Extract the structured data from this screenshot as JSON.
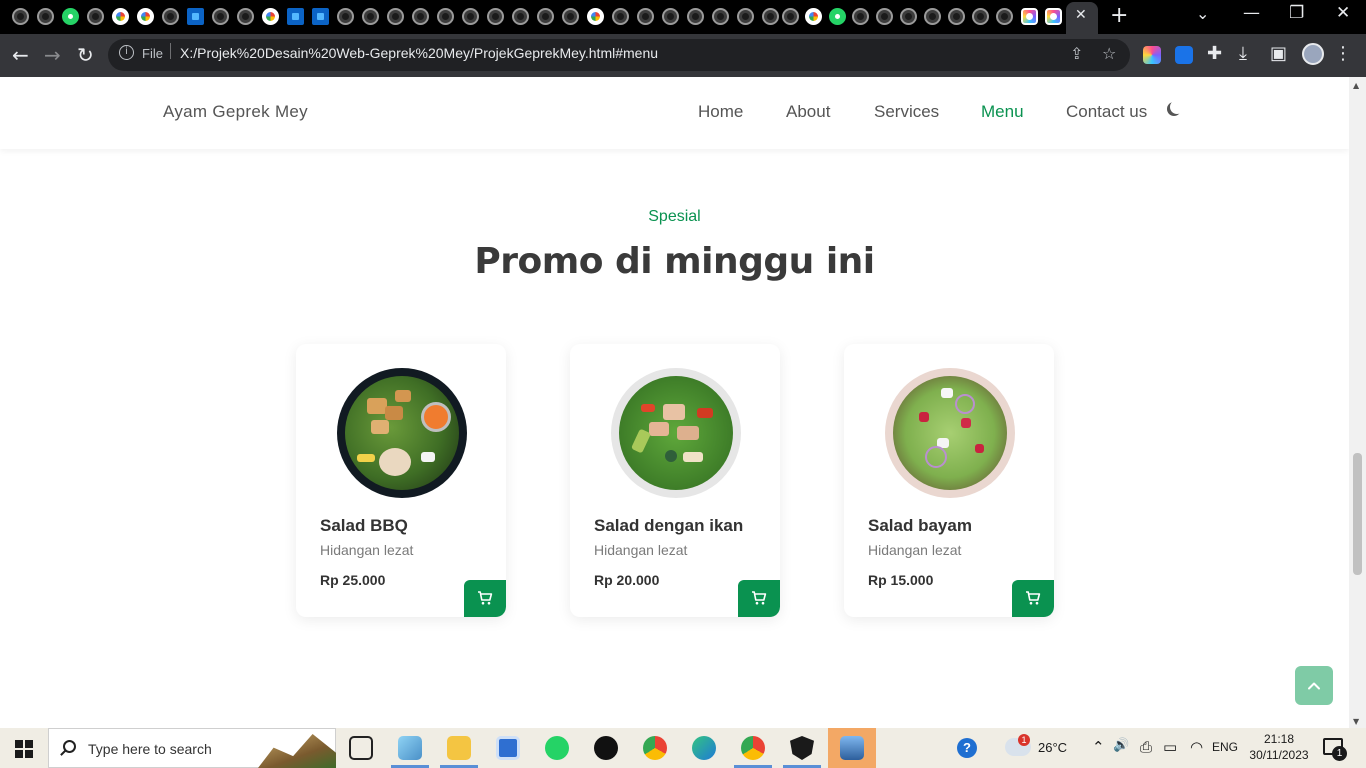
{
  "browser": {
    "tab_close_glyph": "✕",
    "new_tab_glyph": "+",
    "tab_search_glyph": "⌄",
    "window_controls": {
      "minimize": "—",
      "maximize": "❐",
      "close": "✕"
    },
    "nav": {
      "back": "←",
      "forward": "→",
      "reload": "↻"
    },
    "address": {
      "scheme_label": "File",
      "url": "X:/Projek%20Desain%20Web-Geprek%20Mey/ProjekGeprekMey.html#menu"
    },
    "icons": {
      "info": "info-icon",
      "share": "share-icon",
      "bookmark": "star-icon",
      "extensions": "puzzle-icon",
      "downloads": "download-icon",
      "side_panel": "side-panel-icon",
      "menu": "kebab-menu-icon"
    },
    "glyphs": {
      "share": "⇪",
      "star": "☆",
      "puzzle": "✚",
      "download": "⤓",
      "side_panel": "▣",
      "menu": "⋮"
    }
  },
  "site": {
    "brand": "Ayam Geprek Mey",
    "nav": [
      "Home",
      "About",
      "Services",
      "Menu",
      "Contact us"
    ],
    "active_nav": "Menu",
    "theme_toggle_icon": "moon-icon",
    "accent_color": "#0a9250"
  },
  "section": {
    "subtitle": "Spesial",
    "title": "Promo di minggu ini"
  },
  "products": [
    {
      "name": "Salad BBQ",
      "description": "Hidangan lezat",
      "price": "Rp 25.000",
      "image": "bbq-salad-bowl"
    },
    {
      "name": "Salad dengan ikan",
      "description": "Hidangan lezat",
      "price": "Rp 20.000",
      "image": "fish-salad-bowl"
    },
    {
      "name": "Salad bayam",
      "description": "Hidangan lezat",
      "price": "Rp 15.000",
      "image": "spinach-salad-bowl"
    }
  ],
  "cart_icon": "cart-icon",
  "scroll_top_icon": "chevron-up-icon",
  "taskbar": {
    "search_placeholder": "Type here to search",
    "weather": "26°C",
    "weather_badge": "1",
    "language": "ENG",
    "time": "21:18",
    "date": "30/11/2023",
    "notification_count": "1",
    "help_glyph": "?",
    "tray_glyphs": {
      "chevron": "⌃",
      "volume": "🔊",
      "battery": "▭",
      "wifi": "◠"
    }
  }
}
